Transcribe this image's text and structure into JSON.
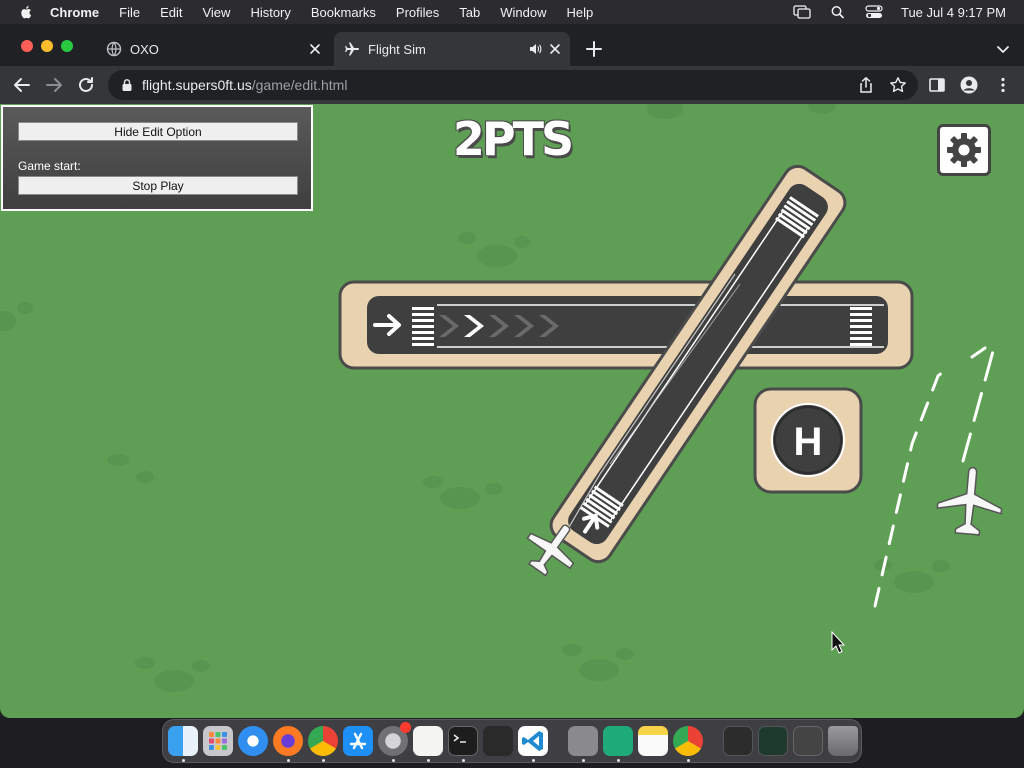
{
  "menubar": {
    "app_name": "Chrome",
    "items": [
      "File",
      "Edit",
      "View",
      "History",
      "Bookmarks",
      "Profiles",
      "Tab",
      "Window",
      "Help"
    ],
    "datetime": "Tue Jul 4  9:17 PM"
  },
  "tabs": [
    {
      "title": "OXO",
      "active": false
    },
    {
      "title": "Flight Sim",
      "active": true
    }
  ],
  "address": {
    "host": "flight.supers0ft.us",
    "path": "/game/edit.html"
  },
  "edit_panel": {
    "hide_label": "Hide Edit Option",
    "start_label": "Game start:",
    "stop_label": "Stop Play"
  },
  "game": {
    "score": "2PTS",
    "helipad_label": "H",
    "colors": {
      "grass": "#5f9f55",
      "runway": "#3f3f3f",
      "runway_border": "#e8d2b0",
      "helipad_border": "#e8d2b0"
    }
  },
  "dock": {
    "apps": [
      "finder-icon",
      "launchpad-icon",
      "safari-icon",
      "firefox-icon",
      "chrome-icon",
      "app-store-icon",
      "system-settings-icon",
      "textedit-icon",
      "terminal-icon",
      "garageband-icon",
      "vscode-icon",
      "calculator-icon",
      "dashlane-icon",
      "notes-icon",
      "chrome-icon",
      "screenshot-1-icon",
      "screenshot-2-icon",
      "screenshot-3-icon",
      "trash-icon"
    ]
  }
}
